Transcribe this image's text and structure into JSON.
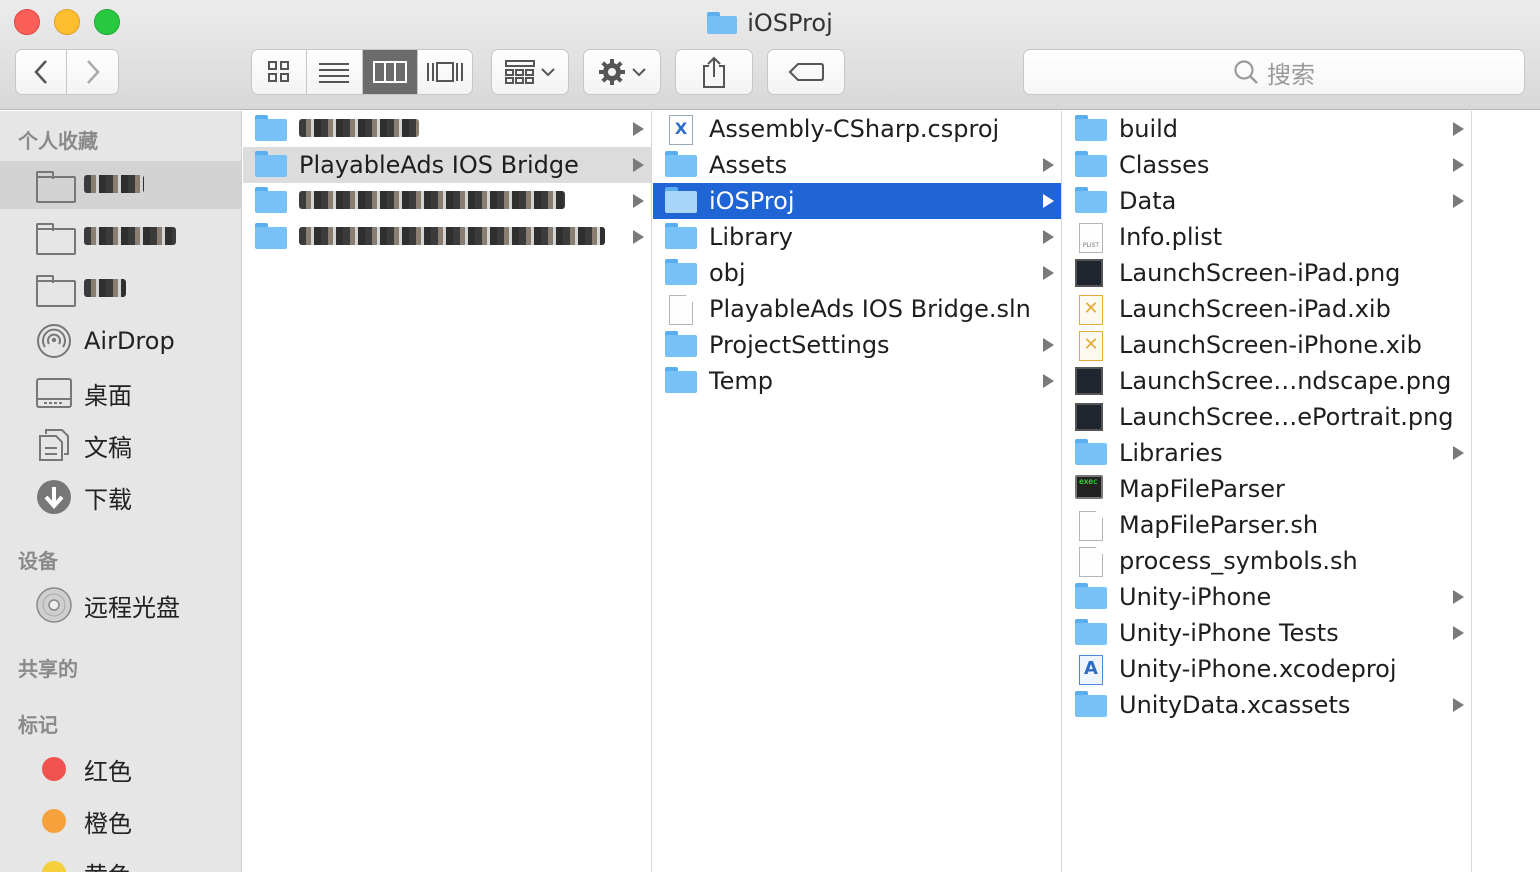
{
  "window": {
    "title": "iOSProj"
  },
  "toolbar": {
    "search_placeholder": "搜索",
    "view_modes": [
      "icon-view",
      "list-view",
      "column-view",
      "cover-flow-view"
    ],
    "active_view": "column-view"
  },
  "sidebar": {
    "favorites_header": "个人收藏",
    "favorites": [
      {
        "label": "",
        "icon": "folder-icon",
        "redacted": true,
        "selected": true
      },
      {
        "label": "",
        "icon": "folder-icon",
        "redacted": true
      },
      {
        "label": "",
        "icon": "folder-icon",
        "redacted": true
      },
      {
        "label": "AirDrop",
        "icon": "airdrop-icon"
      },
      {
        "label": "桌面",
        "icon": "desktop-icon"
      },
      {
        "label": "文稿",
        "icon": "documents-icon"
      },
      {
        "label": "下载",
        "icon": "downloads-icon"
      }
    ],
    "devices_header": "设备",
    "devices": [
      {
        "label": "远程光盘",
        "icon": "disc-icon"
      }
    ],
    "shared_header": "共享的",
    "tags_header": "标记",
    "tags": [
      {
        "label": "红色",
        "color": "#f0524f"
      },
      {
        "label": "橙色",
        "color": "#f6a13b"
      },
      {
        "label": "黄色",
        "color": "#f5cf3c"
      }
    ]
  },
  "columns": [
    {
      "items": [
        {
          "name": "",
          "type": "folder",
          "redacted": true,
          "arrow": true
        },
        {
          "name": "PlayableAds IOS Bridge",
          "type": "folder",
          "arrow": true,
          "selected": "inactive"
        },
        {
          "name": "",
          "type": "folder",
          "redacted": true,
          "arrow": true
        },
        {
          "name": "",
          "type": "folder",
          "redacted": true,
          "arrow": true
        }
      ]
    },
    {
      "items": [
        {
          "name": "Assembly-CSharp.csproj",
          "type": "csproj"
        },
        {
          "name": "Assets",
          "type": "folder",
          "arrow": true
        },
        {
          "name": "iOSProj",
          "type": "folder",
          "arrow": true,
          "selected": "active"
        },
        {
          "name": "Library",
          "type": "folder",
          "arrow": true
        },
        {
          "name": "obj",
          "type": "folder",
          "arrow": true
        },
        {
          "name": "PlayableAds IOS Bridge.sln",
          "type": "doc"
        },
        {
          "name": "ProjectSettings",
          "type": "folder",
          "arrow": true
        },
        {
          "name": "Temp",
          "type": "folder",
          "arrow": true
        }
      ]
    },
    {
      "items": [
        {
          "name": "build",
          "type": "folder",
          "arrow": true
        },
        {
          "name": "Classes",
          "type": "folder",
          "arrow": true
        },
        {
          "name": "Data",
          "type": "folder",
          "arrow": true
        },
        {
          "name": "Info.plist",
          "type": "plist"
        },
        {
          "name": "LaunchScreen-iPad.png",
          "type": "image"
        },
        {
          "name": "LaunchScreen-iPad.xib",
          "type": "xib"
        },
        {
          "name": "LaunchScreen-iPhone.xib",
          "type": "xib"
        },
        {
          "name": "LaunchScree…ndscape.png",
          "type": "image"
        },
        {
          "name": "LaunchScree…ePortrait.png",
          "type": "image"
        },
        {
          "name": "Libraries",
          "type": "folder",
          "arrow": true
        },
        {
          "name": "MapFileParser",
          "type": "terminal"
        },
        {
          "name": "MapFileParser.sh",
          "type": "doc"
        },
        {
          "name": "process_symbols.sh",
          "type": "doc"
        },
        {
          "name": "Unity-iPhone",
          "type": "folder",
          "arrow": true
        },
        {
          "name": "Unity-iPhone Tests",
          "type": "folder",
          "arrow": true
        },
        {
          "name": "Unity-iPhone.xcodeproj",
          "type": "xcodeproj"
        },
        {
          "name": "UnityData.xcassets",
          "type": "folder",
          "arrow": true
        }
      ]
    }
  ]
}
